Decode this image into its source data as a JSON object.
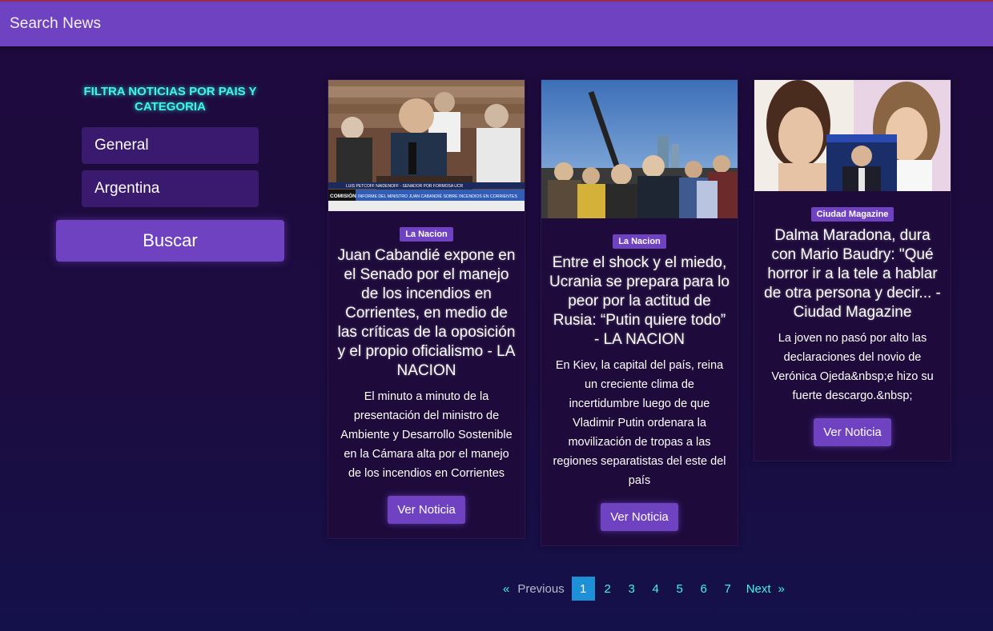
{
  "header": {
    "title": "Search News"
  },
  "sidebar": {
    "filter_title": "FILTRA NOTICIAS POR PAIS Y CATEGORIA",
    "category_value": "General",
    "country_value": "Argentina",
    "search_label": "Buscar"
  },
  "articles": [
    {
      "source": "La Nacion",
      "title": "Juan Cabandié expone en el Senado por el manejo de los incendios en Corrientes, en medio de las críticas de la oposición y el propio oficialismo - LA NACION",
      "description": "El minuto a minuto de la presentación del ministro de Ambiente y Desarrollo Sostenible en la Cámara alta por el manejo de los incendios en Corrientes",
      "button": "Ver Noticia",
      "image_caption_1": "LUIS PETCOFF NAIDENOFF - SENADOR POR FORMOSA UCR",
      "image_caption_2": "INFORME DEL MINISTRO JUAN CABANDIÉ SOBRE INCENDIOS EN CORRIENTES",
      "image_tag": "COMISIÓN"
    },
    {
      "source": "La Nacion",
      "title": "Entre el shock y el miedo, Ucrania se prepara para lo peor por la actitud de Rusia: “Putin quiere todo” - LA NACION",
      "description": "En Kiev, la capital del país, reina un creciente clima de incertidumbre luego de que Vladimir Putin ordenara la movilización de tropas a las regiones separatistas del este del país",
      "button": "Ver Noticia"
    },
    {
      "source": "Ciudad Magazine",
      "title": "Dalma Maradona, dura con Mario Baudry: \"Qué horror ir a la tele a hablar de otra persona y decir... - Ciudad Magazine",
      "description": "La joven no pasó por alto las declaraciones del novio de Verónica Ojeda&nbsp;e hizo su fuerte descargo.&nbsp;",
      "button": "Ver Noticia"
    }
  ],
  "pagination": {
    "prev_arrow": "«",
    "prev_label": "Previous",
    "pages": [
      "1",
      "2",
      "3",
      "4",
      "5",
      "6",
      "7"
    ],
    "current": "1",
    "next_label": "Next",
    "next_arrow": "»"
  },
  "colors": {
    "accent": "#6f42c1",
    "neon": "#3ef5e6",
    "active_page": "#1e90d8",
    "background": "#1f0a3d"
  }
}
